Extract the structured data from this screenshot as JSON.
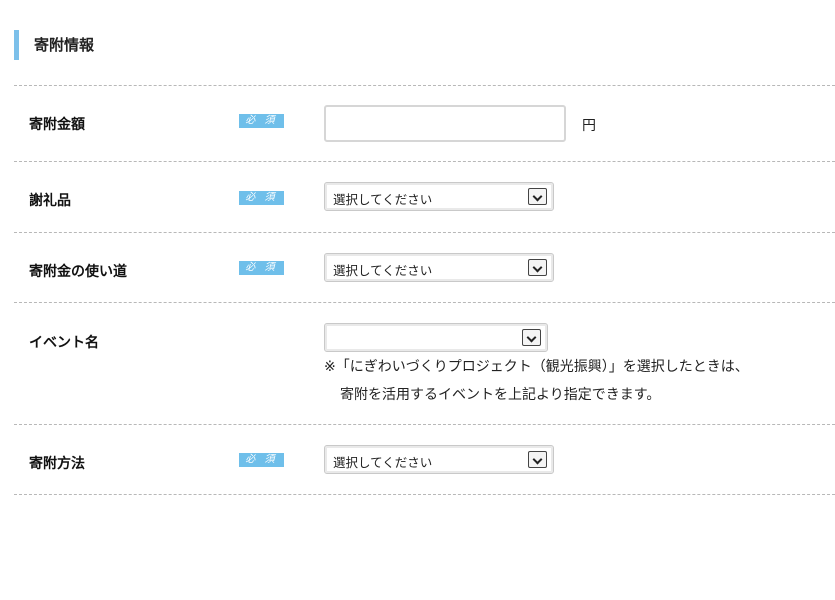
{
  "section": {
    "title": "寄附情報"
  },
  "required_label": "必 須",
  "rows": {
    "amount": {
      "label": "寄附金額",
      "value": "",
      "unit": "円"
    },
    "gift": {
      "label": "謝礼品",
      "selected": "選択してください"
    },
    "usage": {
      "label": "寄附金の使い道",
      "selected": "選択してください"
    },
    "event": {
      "label": "イベント名",
      "selected": "",
      "note_line1": "※「にぎわいづくりプロジェクト（観光振興）」を選択したときは、",
      "note_line2": "寄附を活用するイベントを上記より指定できます。"
    },
    "method": {
      "label": "寄附方法",
      "selected": "選択してください"
    }
  },
  "icons": {
    "select_arrow": "chevron-down-icon"
  },
  "colors": {
    "accent": "#7cc0ea",
    "badge": "#6fbfea"
  }
}
